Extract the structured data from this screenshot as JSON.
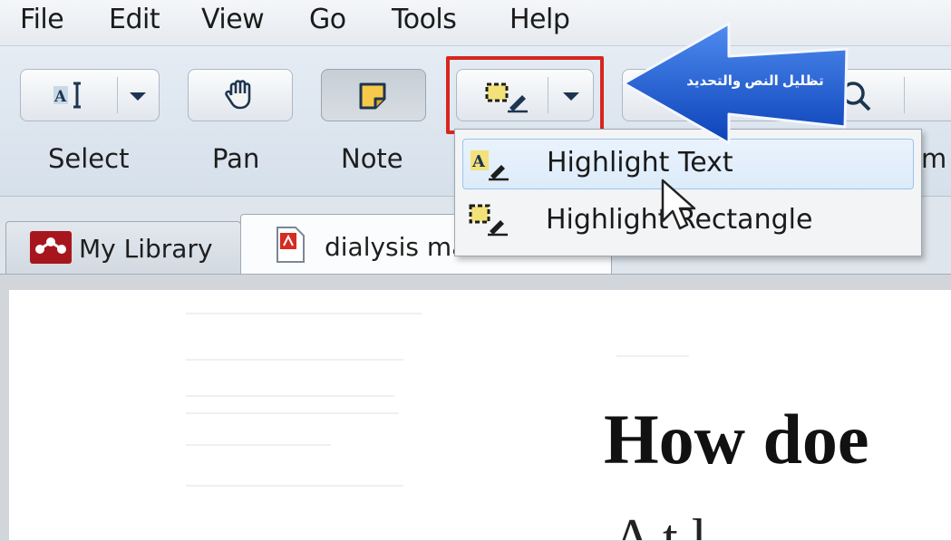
{
  "menubar": {
    "items": [
      "File",
      "Edit",
      "View",
      "Go",
      "Tools",
      "Help"
    ]
  },
  "toolbar": {
    "select_label": "Select",
    "pan_label": "Pan",
    "note_label": "Note",
    "partial_label": "m"
  },
  "callout": {
    "text": "تظليل النص  والتحديد",
    "color": "#1a5fd6"
  },
  "dropdown": {
    "items": [
      {
        "label": "Highlight Text",
        "icon": "highlight-text-icon",
        "hovered": true
      },
      {
        "label": "Highlight Rectangle",
        "icon": "highlight-rectangle-icon",
        "hovered": false
      }
    ]
  },
  "tabs": [
    {
      "label": "My Library",
      "icon": "mendeley-logo-icon"
    },
    {
      "label": "dialysis ma",
      "icon": "pdf-document-icon"
    }
  ],
  "document": {
    "heading": "How doe",
    "subheading": "A t   l"
  },
  "colors": {
    "highlight_border": "#d7261e",
    "accent": "#1a5fd6"
  }
}
